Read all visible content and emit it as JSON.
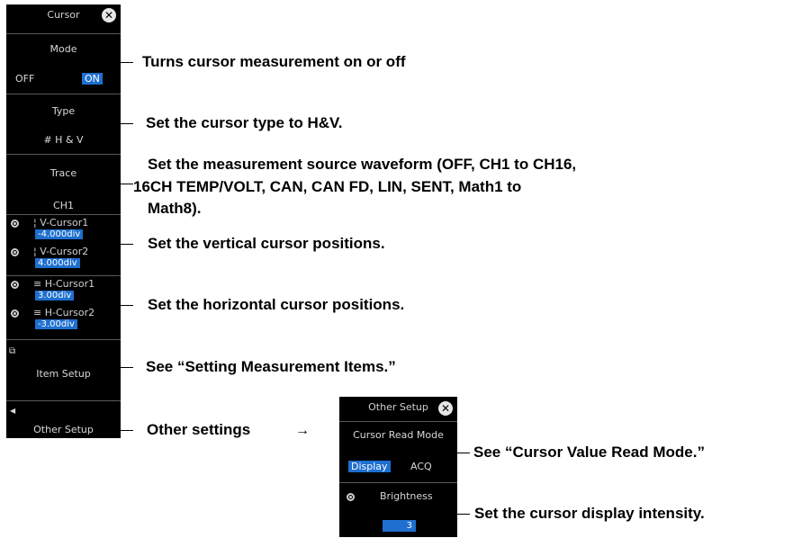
{
  "cursor_panel": {
    "title": "Cursor",
    "mode": {
      "label": "Mode",
      "off": "OFF",
      "on": "ON"
    },
    "type": {
      "label": "Type",
      "value": "H & V",
      "icon": "hv-cursor-icon"
    },
    "trace": {
      "label": "Trace",
      "value": "CH1"
    },
    "v_cursor1": {
      "label": "V-Cursor1",
      "value": "-4.000div"
    },
    "v_cursor2": {
      "label": "V-Cursor2",
      "value": "4.000div"
    },
    "h_cursor1": {
      "label": "H-Cursor1",
      "value": "3.00div"
    },
    "h_cursor2": {
      "label": "H-Cursor2",
      "value": "-3.00div"
    },
    "item_setup": "Item Setup",
    "other_setup": "Other Setup"
  },
  "other_setup_panel": {
    "title": "Other Setup",
    "read_mode_label": "Cursor Read Mode",
    "display": "Display",
    "acq": "ACQ",
    "brightness_label": "Brightness",
    "brightness_value": "3"
  },
  "annotations": {
    "mode": "Turns cursor measurement on or off",
    "type": "Set the cursor type to H&V.",
    "trace_line1": "Set the measurement source waveform (OFF, CH1 to CH16,",
    "trace_line2": "16CH TEMP/VOLT, CAN, CAN FD, LIN, SENT, Math1 to",
    "trace_line3": "Math8).",
    "vertical": "Set the vertical cursor positions.",
    "horizontal": "Set the horizontal cursor positions.",
    "item_setup": "See “Setting Measurement Items.”",
    "other_settings": "Other settings",
    "read_mode": "See “Cursor Value Read Mode.”",
    "brightness": "Set the cursor display intensity."
  },
  "colors": {
    "highlight": "#1e6fcf",
    "panel_bg": "#000000"
  }
}
